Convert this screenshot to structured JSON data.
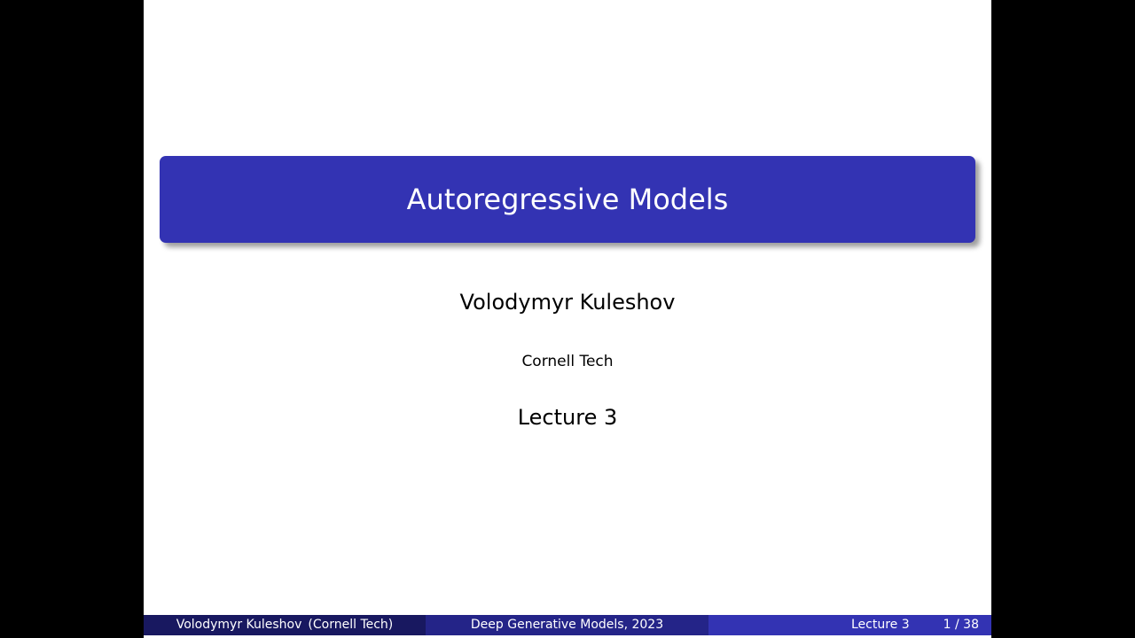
{
  "slide": {
    "title": "Autoregressive Models",
    "author": "Volodymyr Kuleshov",
    "institute": "Cornell Tech",
    "date": "Lecture 3"
  },
  "footer": {
    "author": "Volodymyr Kuleshov",
    "institute": "(Cornell Tech)",
    "course": "Deep Generative Models, 2023",
    "lecture": "Lecture 3",
    "page": "1 / 38"
  },
  "colors": {
    "title_box": "#3333b3",
    "footer_left": "#181860",
    "footer_mid": "#242488",
    "footer_right": "#3333b3"
  }
}
